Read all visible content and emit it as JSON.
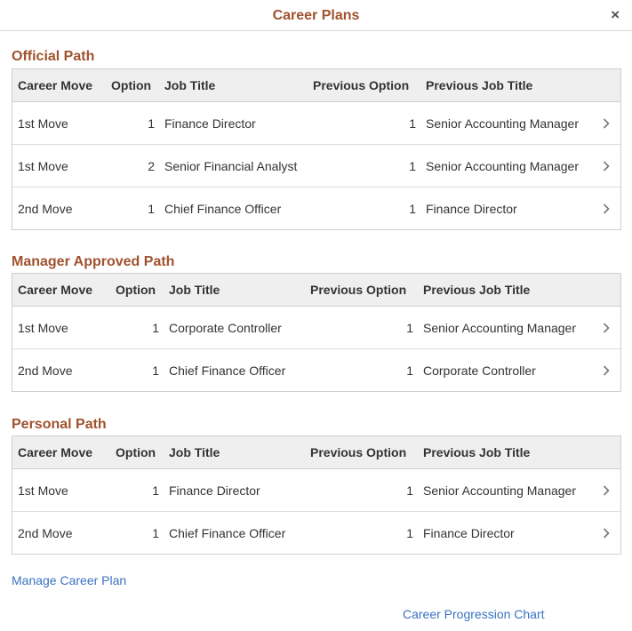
{
  "dialog": {
    "title": "Career Plans",
    "close_symbol": "×"
  },
  "columns": {
    "career_move": "Career Move",
    "option": "Option",
    "job_title": "Job Title",
    "previous_option": "Previous Option",
    "previous_job_title": "Previous Job Title"
  },
  "official_path": {
    "title": "Official Path",
    "rows": [
      {
        "move": "1st Move",
        "option": "1",
        "job": "Finance Director",
        "prev_option": "1",
        "prev_job": "Senior Accounting Manager"
      },
      {
        "move": "1st Move",
        "option": "2",
        "job": "Senior Financial Analyst",
        "prev_option": "1",
        "prev_job": "Senior Accounting Manager"
      },
      {
        "move": "2nd Move",
        "option": "1",
        "job": "Chief Finance Officer",
        "prev_option": "1",
        "prev_job": "Finance Director"
      }
    ]
  },
  "manager_path": {
    "title": "Manager Approved Path",
    "rows": [
      {
        "move": "1st Move",
        "option": "1",
        "job": "Corporate Controller",
        "prev_option": "1",
        "prev_job": "Senior Accounting Manager"
      },
      {
        "move": "2nd Move",
        "option": "1",
        "job": "Chief Finance Officer",
        "prev_option": "1",
        "prev_job": "Corporate Controller"
      }
    ]
  },
  "personal_path": {
    "title": "Personal Path",
    "rows": [
      {
        "move": "1st Move",
        "option": "1",
        "job": "Finance Director",
        "prev_option": "1",
        "prev_job": "Senior Accounting Manager"
      },
      {
        "move": "2nd Move",
        "option": "1",
        "job": "Chief Finance Officer",
        "prev_option": "1",
        "prev_job": "Finance Director"
      }
    ]
  },
  "links": {
    "manage_career_plan": "Manage Career Plan",
    "career_progression_chart": "Career Progression Chart"
  },
  "icons": {
    "row_action": "chevron-right-icon",
    "close": "close-icon"
  },
  "colors": {
    "section_title": "#a0522d",
    "link": "#3a72c2",
    "header_bg": "#efefef"
  }
}
